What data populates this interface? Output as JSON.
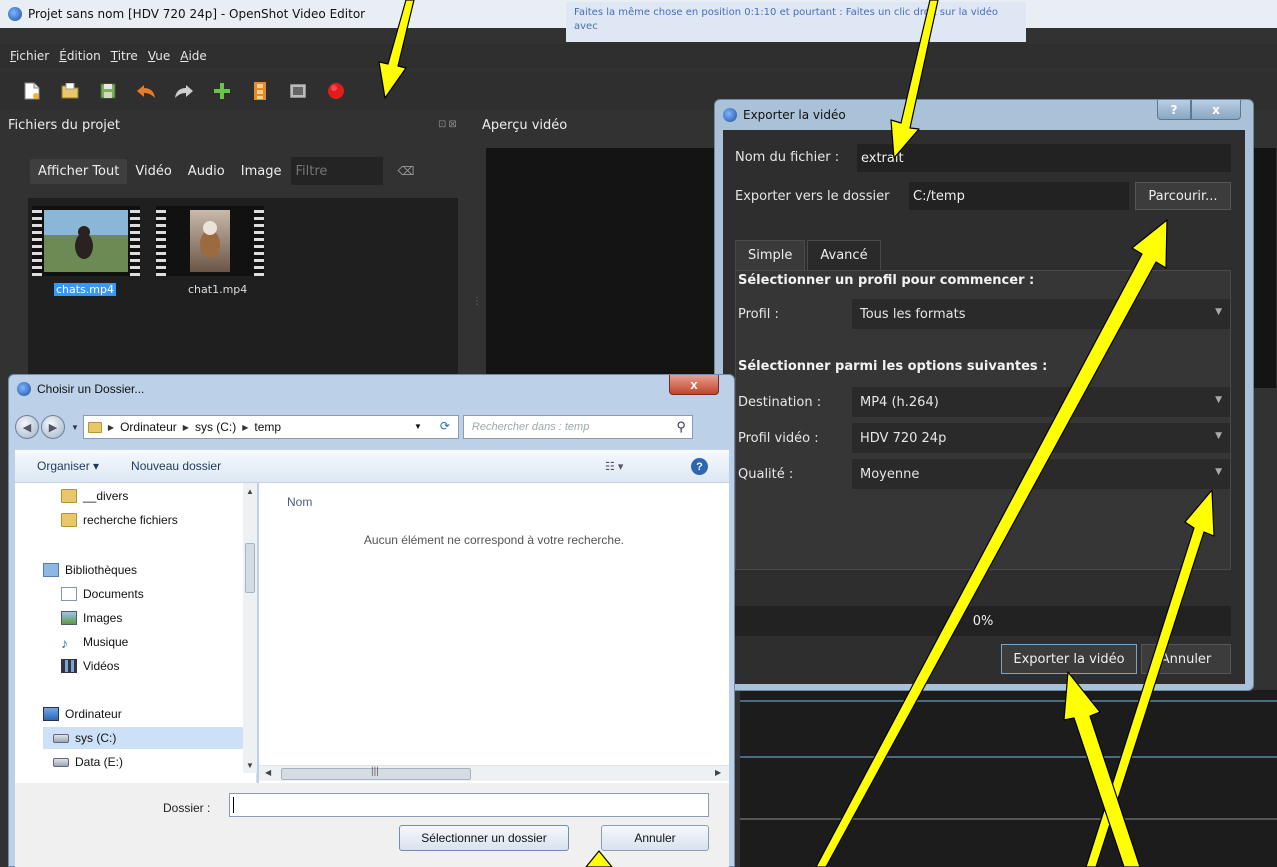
{
  "main": {
    "title": "Projet sans nom [HDV 720 24p] - OpenShot Video Editor",
    "menu": [
      "Fichier",
      "Édition",
      "Titre",
      "Vue",
      "Aide"
    ],
    "background_text": "Faites la même chose en position 0:1:10 et pourtant : Faites un clic droit sur la vidéo avec",
    "files_panel_title": "Fichiers du projet",
    "files_panel_buttons": "⊡⊠",
    "preview_title": "Aperçu vidéo",
    "filters": [
      "Afficher Tout",
      "Vidéo",
      "Audio",
      "Image"
    ],
    "filter_placeholder": "Filtre",
    "files": [
      {
        "name": "chats.mp4"
      },
      {
        "name": "chat1.mp4"
      }
    ]
  },
  "export": {
    "title": "Exporter la vidéo",
    "help": "?",
    "close": "x",
    "filename_label": "Nom du fichier :",
    "filename_value": "extrait",
    "folder_label": "Exporter vers le dossier",
    "folder_value": "C:/temp",
    "browse": "Parcourir...",
    "tabs": [
      "Simple",
      "Avancé"
    ],
    "profile_section": "Sélectionner un profil pour commencer :",
    "profile_label": "Profil :",
    "profile_value": "Tous les formats",
    "options_section": "Sélectionner parmi les options suivantes :",
    "destination_label": "Destination :",
    "destination_value": "MP4 (h.264)",
    "video_profile_label": "Profil vidéo :",
    "video_profile_value": "HDV 720 24p",
    "quality_label": "Qualité :",
    "quality_value": "Moyenne",
    "progress": "0%",
    "export_button": "Exporter la vidéo",
    "cancel_button": "Annuler"
  },
  "folder": {
    "title": "Choisir un Dossier...",
    "close": "x",
    "breadcrumb": [
      "Ordinateur",
      "sys (C:)",
      "temp"
    ],
    "search_placeholder": "Rechercher dans : temp",
    "organize": "Organiser ▾",
    "new_folder": "Nouveau dossier",
    "tree": [
      {
        "label": "__divers"
      },
      {
        "label": "recherche fichiers"
      },
      {
        "label": "Bibliothèques"
      },
      {
        "label": "Documents"
      },
      {
        "label": "Images"
      },
      {
        "label": "Musique"
      },
      {
        "label": "Vidéos"
      },
      {
        "label": "Ordinateur"
      },
      {
        "label": "sys (C:)"
      },
      {
        "label": "Data (E:)"
      }
    ],
    "column_name": "Nom",
    "empty_message": "Aucun élément ne correspond à votre recherche.",
    "folder_label": "Dossier :",
    "folder_value": "",
    "select_button": "Sélectionner un dossier",
    "cancel_button": "Annuler"
  },
  "colors": {
    "annotation": "#ffff00",
    "accent": "#3399ff"
  }
}
